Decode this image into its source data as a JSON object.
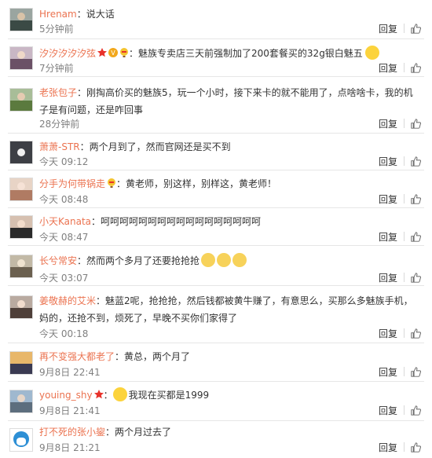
{
  "comments": [
    {
      "author": "Hrenam",
      "text": "：说大话",
      "time": "5分钟前"
    },
    {
      "author": "汐汐汐汐汐弦",
      "text": "：魅族专卖店三天前强制加了200套餐买的32g银白魅五",
      "time": "7分钟前"
    },
    {
      "author": "老张包子",
      "text": "：刚掏高价买的魅族5，玩一个小时，接下来卡的就不能用了，点啥啥卡，我的机子是有问题，还是咋回事",
      "time": "28分钟前"
    },
    {
      "author": "萧萧-STR",
      "text": "：两个月到了，然而官网还是买不到",
      "time": "今天 09:12"
    },
    {
      "author": "分手为何带锅走",
      "text": "：黄老师，别这样，别样这，黄老师！",
      "time": "今天 08:48"
    },
    {
      "author": "小天Kanata",
      "text": "：呵呵呵呵呵呵呵呵呵呵呵呵呵呵呵呵呵",
      "time": "今天 08:47"
    },
    {
      "author": "长兮常安",
      "text": "：然而两个多月了还要抢抢抢",
      "time": "今天 03:07"
    },
    {
      "author": "姜敬赫的艾米",
      "text": "：魅蓝2呢，抢抢抢，然后钱都被黄牛赚了，有意思么，买那么多魅族手机，妈的，还抢不到，烦死了，早晚不买你们家得了",
      "time": "今天 00:18"
    },
    {
      "author": "再不变强大都老了",
      "text": "：黄总，两个月了",
      "time": "9月8日 22:41"
    },
    {
      "author": "youing_shy",
      "text": "我现在买都是1999",
      "time": "9月8日 21:41"
    },
    {
      "author": "打不死的张小鋆",
      "text": "：两个月过去了",
      "time": "9月8日 21:21"
    }
  ],
  "reply_label": "回复",
  "icons": {
    "like": "thumbs-up-icon",
    "badge": "vip-badge-icon",
    "emoji": "emoji-icon"
  },
  "colors": {
    "author": "#eb7350",
    "text": "#333333",
    "time": "#808080",
    "divider": "#e6e6e6"
  }
}
